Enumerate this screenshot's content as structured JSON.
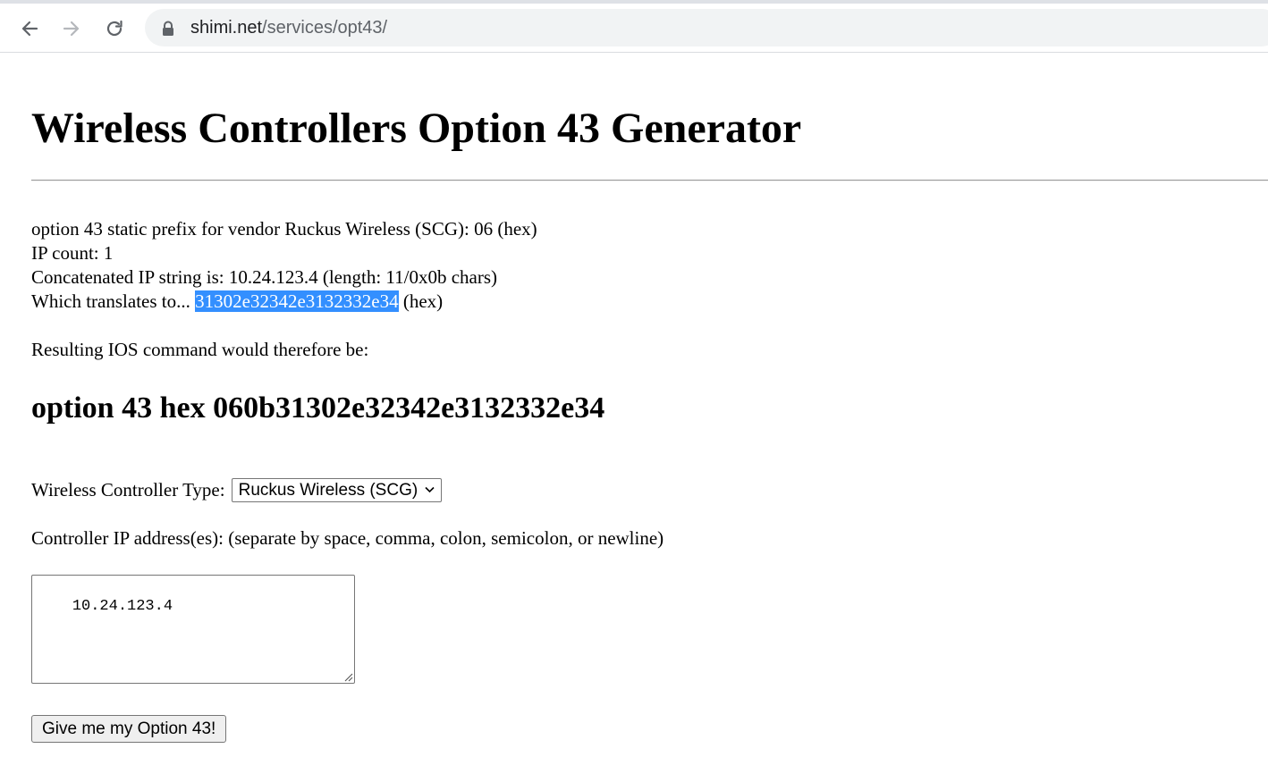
{
  "browser": {
    "url_host": "shimi.net",
    "url_path": "/services/opt43/",
    "icons": {
      "back": "arrow-left-icon",
      "forward": "arrow-right-icon",
      "reload": "reload-icon",
      "security": "lock-icon"
    }
  },
  "page": {
    "title": "Wireless Controllers Option 43 Generator",
    "info": {
      "prefix_text": "option 43 static prefix for vendor Ruckus Wireless (SCG): 06 (hex)",
      "ip_count_text": "IP count: 1",
      "concat_text": "Concatenated IP string is: 10.24.123.4 (length: 11/0x0b chars)",
      "translates_prefix": "Which translates to... ",
      "translates_hex": "31302e32342e3132332e34",
      "translates_suffix": " (hex)"
    },
    "resulting_text": "Resulting IOS command would therefore be:",
    "command": "option 43 hex 060b31302e32342e3132332e34",
    "form": {
      "type_label": "Wireless Controller Type:",
      "type_selected": "Ruckus Wireless (SCG)",
      "ip_label": "Controller IP address(es): (separate by space, comma, colon, semicolon, or newline)",
      "ip_value": "10.24.123.4",
      "submit_label": "Give me my Option 43!"
    },
    "colors": {
      "selection_bg": "#338fff",
      "selection_fg": "#ffffff"
    }
  }
}
